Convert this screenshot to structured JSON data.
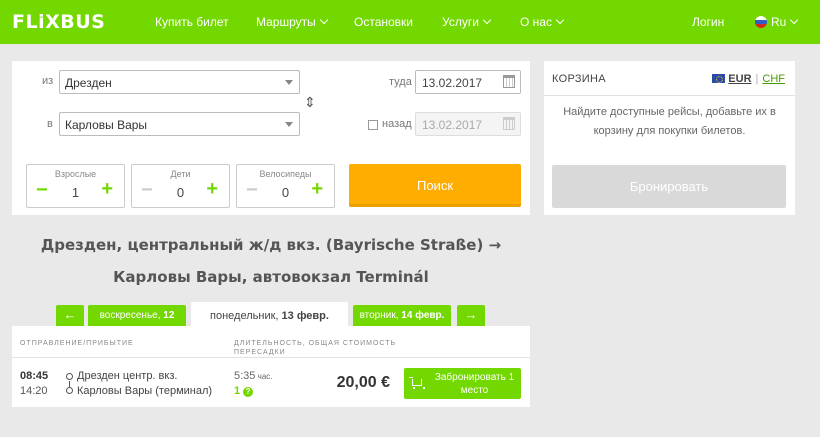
{
  "header": {
    "logo": "FLiXBUS",
    "nav": {
      "buy": "Купить билет",
      "routes": "Маршруты",
      "stops": "Остановки",
      "services": "Услуги",
      "about": "О нас",
      "login": "Логин",
      "lang": "Ru"
    }
  },
  "search": {
    "from_label": "из",
    "from_value": "Дрезден",
    "to_label": "в",
    "to_value": "Карловы Вары",
    "depart_label": "туда",
    "depart_value": "13.02.2017",
    "return_label": "назад",
    "return_value": "13.02.2017",
    "adults_label": "Взрослые",
    "adults_value": "1",
    "children_label": "Дети",
    "children_value": "0",
    "bikes_label": "Велосипеды",
    "bikes_value": "0",
    "minus": "−",
    "plus": "+",
    "search_button": "Поиск"
  },
  "cart": {
    "title": "КОРЗИНА",
    "eur": "EUR",
    "sep": "|",
    "chf": "CHF",
    "note": "Найдите доступные рейсы, добавьте их в корзину для покупки билетов.",
    "book_button": "Бронировать"
  },
  "route": {
    "line1": "Дрезден, центральный ж/д вкз. (Bayrische Straße) →",
    "line2": "Карловы Вары, автовокзал Terminál"
  },
  "dates": {
    "prev_arrow": "←",
    "next_arrow": "→",
    "prev_day": "воскресенье, ",
    "prev_date": "12",
    "current_day": "понедельник, ",
    "current_date": "13 февр.",
    "next_day": "вторник, ",
    "next_date": "14 февр."
  },
  "results": {
    "headers": {
      "dep_arr": "ОТПРАВЛЕНИЕ/ПРИБЫТИЕ",
      "duration_1": "ДЛИТЕЛЬНОСТЬ,",
      "duration_2": "ПЕРЕСАДКИ",
      "total": "ОБЩАЯ СТОИМОСТЬ"
    },
    "rows": [
      {
        "dep_time": "08:45",
        "arr_time": "14:20",
        "dep_station": "Дрезден центр. вкз.",
        "arr_station": "Карловы Вары (терминал)",
        "duration": "5:35",
        "duration_unit": " час.",
        "transfers": "1",
        "help": "?",
        "price": "20,00 €",
        "book_label": "Забронировать 1 место"
      }
    ]
  },
  "colors": {
    "brand_green": "#73d700",
    "search_orange": "#ffad00",
    "disabled_grey": "#d9d9d9"
  }
}
